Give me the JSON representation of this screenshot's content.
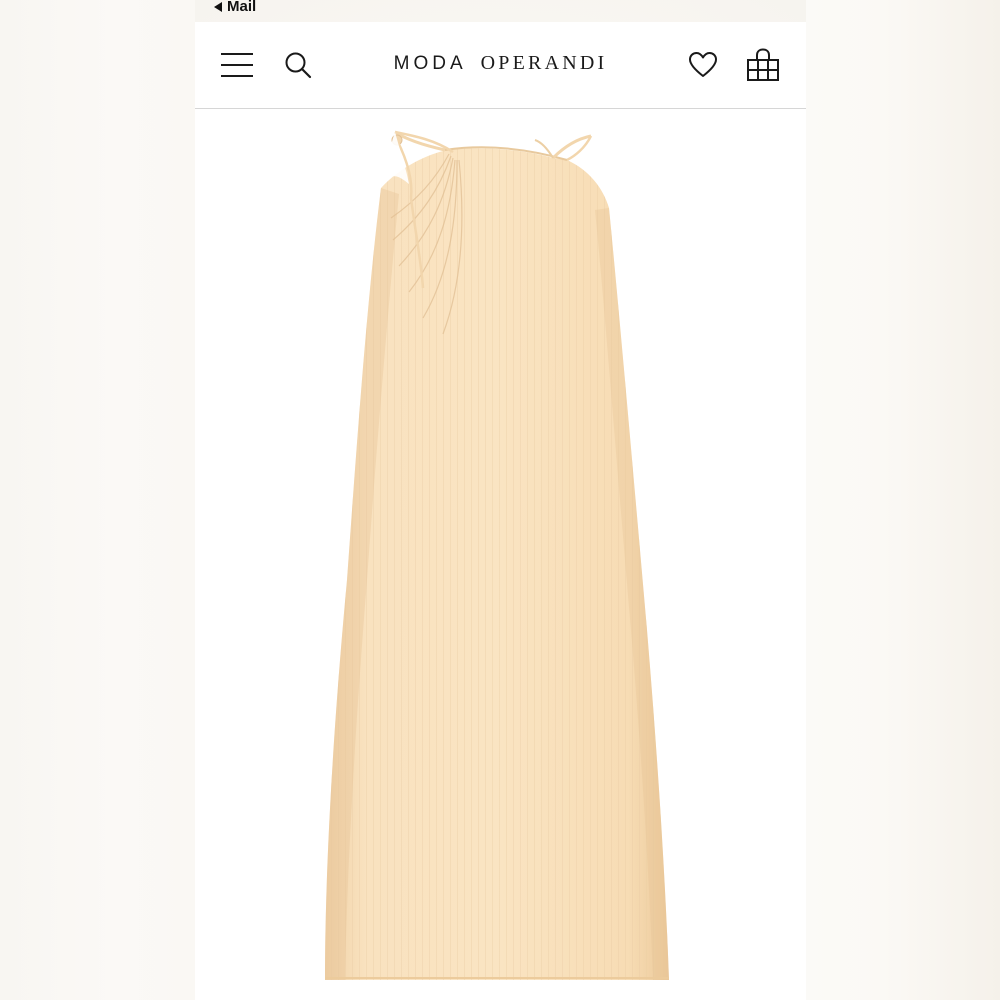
{
  "status_bar": {
    "back_label": "Mail"
  },
  "header": {
    "brand_part1": "MODA",
    "brand_part2": "OPERANDI",
    "icons": [
      "menu-icon",
      "search-icon",
      "heart-icon",
      "shopping-bag-icon"
    ]
  },
  "product": {
    "image": "cream ribbed sleeveless midi dress with asymmetric tie strap"
  },
  "colors": {
    "dress": "#f8dfb8",
    "dress_shadow": "#eccb9c",
    "header_text": "#1a1a1a",
    "divider": "#d6d6d6"
  }
}
